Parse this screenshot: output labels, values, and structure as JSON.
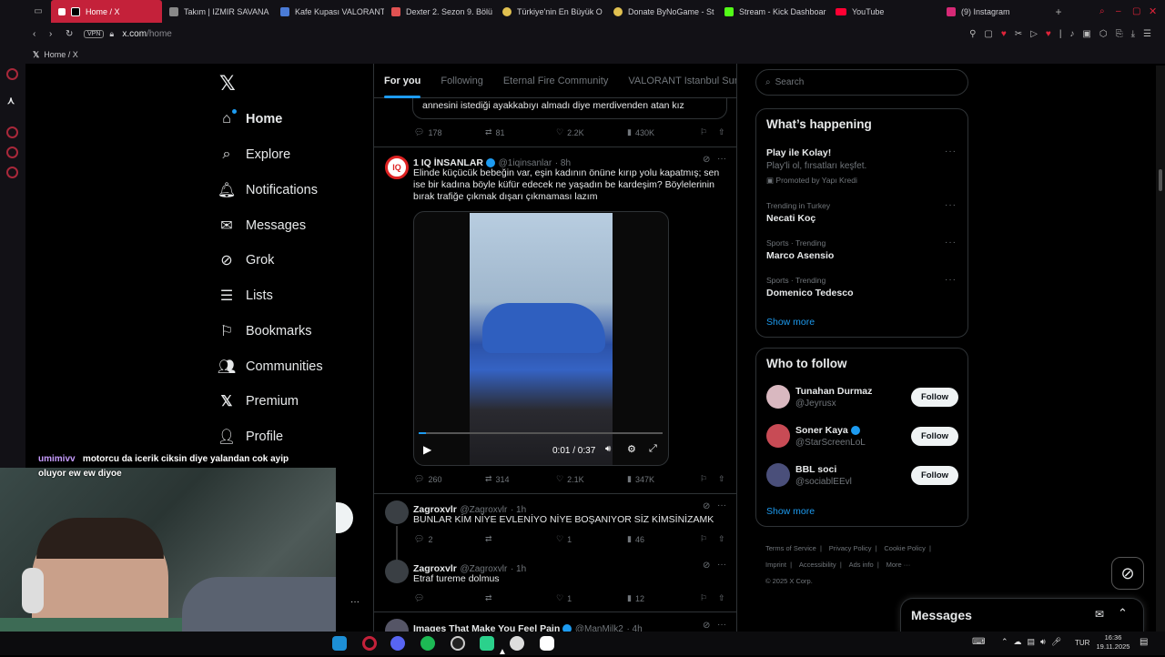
{
  "browser": {
    "tabs": [
      {
        "label": "Home / X",
        "color": "#ffffff",
        "active": true
      },
      {
        "label": "Takım | IZMIR SAVANA",
        "color": "#c0c0c0"
      },
      {
        "label": "Kafe Kupası VALORANT",
        "color": "#4a7bd6"
      },
      {
        "label": "Dexter 2. Sezon 9. Bölü",
        "color": "#e05252"
      },
      {
        "label": "Türkiye'nin En Büyük O",
        "color": "#e0c050"
      },
      {
        "label": "Donate ByNoGame - St",
        "color": "#e0c050"
      },
      {
        "label": "Stream - Kick Dashboar",
        "color": "#53fc18"
      },
      {
        "label": "YouTube",
        "color": "#ff0033"
      },
      {
        "label": "(9) Instagram",
        "color": "#d62976"
      }
    ],
    "vpn": "VPN",
    "url_host": "x.com",
    "url_path": "/home",
    "page_title": "Home / X"
  },
  "nav": {
    "items": [
      {
        "label": "Home",
        "icon": "home-icon"
      },
      {
        "label": "Explore",
        "icon": "search-icon"
      },
      {
        "label": "Notifications",
        "icon": "bell-icon"
      },
      {
        "label": "Messages",
        "icon": "envelope-icon"
      },
      {
        "label": "Grok",
        "icon": "grok-icon"
      },
      {
        "label": "Lists",
        "icon": "list-icon"
      },
      {
        "label": "Bookmarks",
        "icon": "bookmark-icon"
      },
      {
        "label": "Communities",
        "icon": "communities-icon"
      },
      {
        "label": "Premium",
        "icon": "x-icon"
      },
      {
        "label": "Profile",
        "icon": "profile-icon"
      }
    ]
  },
  "feed": {
    "tabs": [
      "For you",
      "Following",
      "Eternal Fire Community",
      "VALORANT Istanbul Sunucusu"
    ],
    "quoted_text": "annesini istediği ayakkabıyı almadı diye merdivenden atan kız",
    "post0_stats": {
      "replies": "178",
      "reposts": "81",
      "likes": "2.2K",
      "views": "430K"
    },
    "post1": {
      "name": "1 IQ İNSANLAR",
      "handle": "@1iqinsanlar",
      "time": "· 8h",
      "text": "Elinde küçücük bebeğin var, eşin kadının önüne kırıp yolu kapatmış; sen ise bir kadına böyle küfür edecek ne yaşadın be kardeşim? Böylelerinin bırak trafiğe  çıkmak dışarı çıkmaması lazım",
      "video_time": "0:01 / 0:37",
      "video_progress": 0.03,
      "stats": {
        "replies": "260",
        "reposts": "314",
        "likes": "2.1K",
        "views": "347K"
      }
    },
    "post2": {
      "name": "Zagroxvlr",
      "handle": "@Zagroxvlr",
      "time": "· 1h",
      "text": "BUNLAR KİM NİYE EVLENİYO NİYE BOŞANIYOR SİZ KİMSİNİZAMK",
      "stats": {
        "replies": "2",
        "reposts": "",
        "likes": "1",
        "views": "46"
      }
    },
    "post3": {
      "name": "Zagroxvlr",
      "handle": "@Zagroxvlr",
      "time": "· 1h",
      "text": "Etraf tureme dolmus",
      "stats": {
        "replies": "",
        "reposts": "",
        "likes": "1",
        "views": "12"
      }
    },
    "post4": {
      "name": "Images That Make You Feel Pain",
      "handle": "@ManMilk2",
      "time": "· 4h"
    }
  },
  "right": {
    "search_placeholder": "Search",
    "happening_title": "What’s happening",
    "promo": {
      "title": "Play ile Kolay!",
      "sub": "Play'li ol, fırsatları keşfet.",
      "promoted": "Promoted by Yapı Kredi"
    },
    "trends": [
      {
        "context": "Trending in Turkey",
        "name": "Necati Koç"
      },
      {
        "context": "Sports · Trending",
        "name": "Marco Asensio"
      },
      {
        "context": "Sports · Trending",
        "name": "Domenico Tedesco"
      }
    ],
    "show_more": "Show more",
    "who_title": "Who to follow",
    "who": [
      {
        "name": "Tunahan Durmaz",
        "handle": "@Jeyrusx",
        "verified": false
      },
      {
        "name": "Soner Kaya",
        "handle": "@StarScreenLoL",
        "verified": true
      },
      {
        "name": "BBL soci",
        "handle": "@sociablEEvl",
        "verified": false
      }
    ],
    "follow_label": "Follow",
    "footer": [
      "Terms of Service",
      "Privacy Policy",
      "Cookie Policy",
      "Imprint",
      "Accessibility",
      "Ads info",
      "More ···"
    ],
    "copyright": "© 2025 X Corp.",
    "messages_label": "Messages"
  },
  "chat": {
    "user": "umimivv",
    "message": "motorcu da icerik ciksin diye yalandan cok ayip oluyor ew ew diyoe"
  },
  "taskbar": {
    "lang": "TUR",
    "time": "16:36",
    "date": "19.11.2025"
  }
}
